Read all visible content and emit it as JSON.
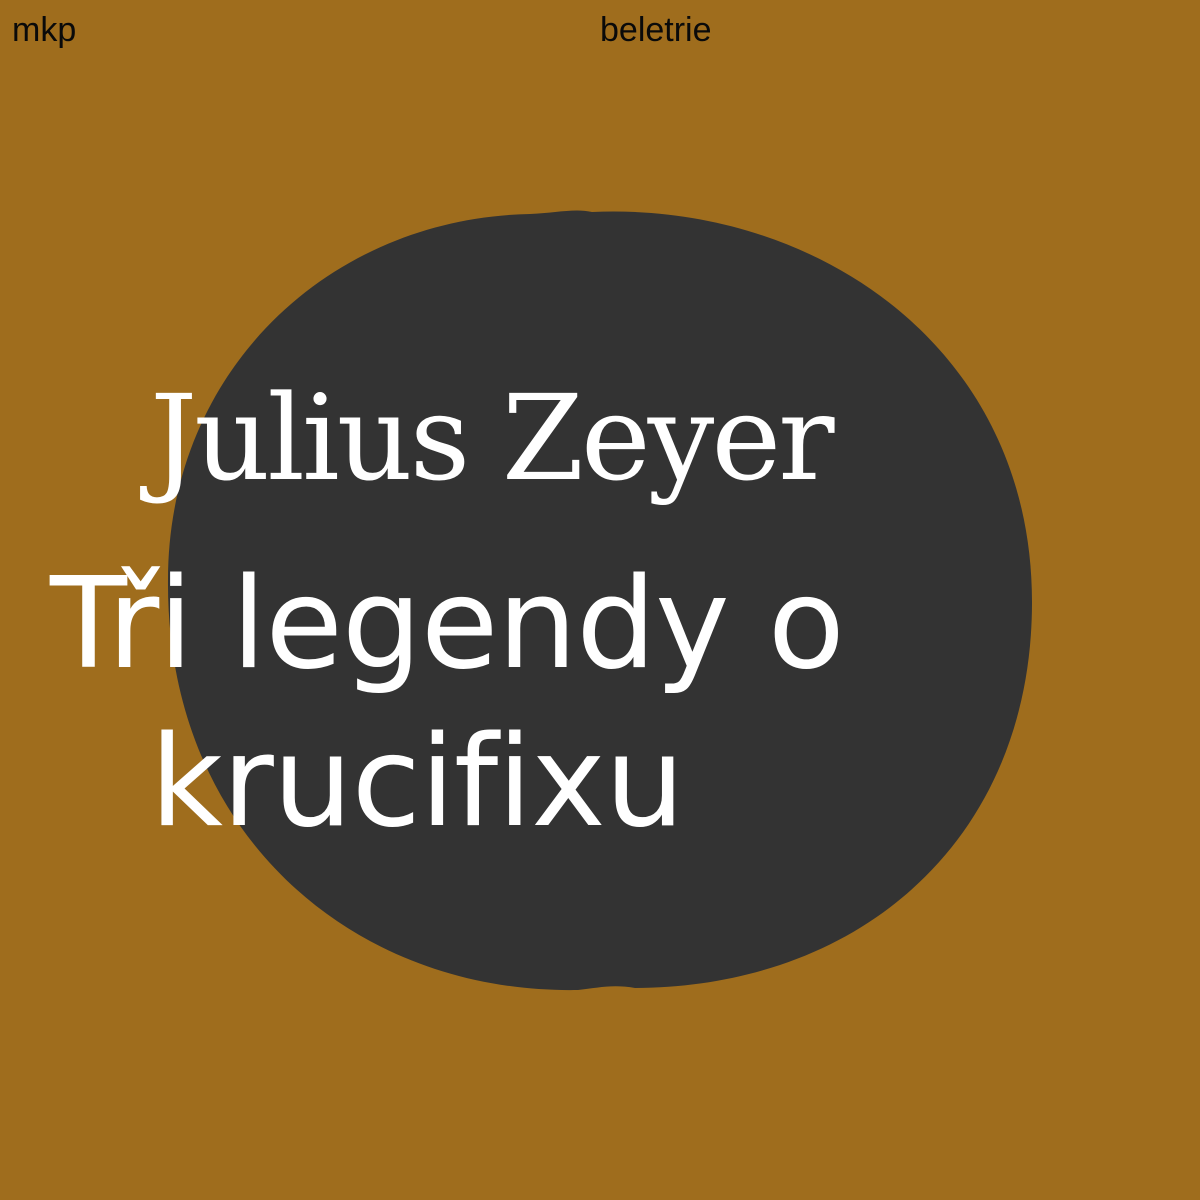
{
  "cover": {
    "publisher": "mkp",
    "category": "beletrie",
    "author": "Julius Zeyer",
    "title_lines": [
      "Tři legendy o",
      "krucifixu"
    ]
  },
  "colors": {
    "background": "#9f6d1d",
    "circle": "#333333",
    "text": "#ffffff",
    "label_text": "#0a0a0a"
  }
}
